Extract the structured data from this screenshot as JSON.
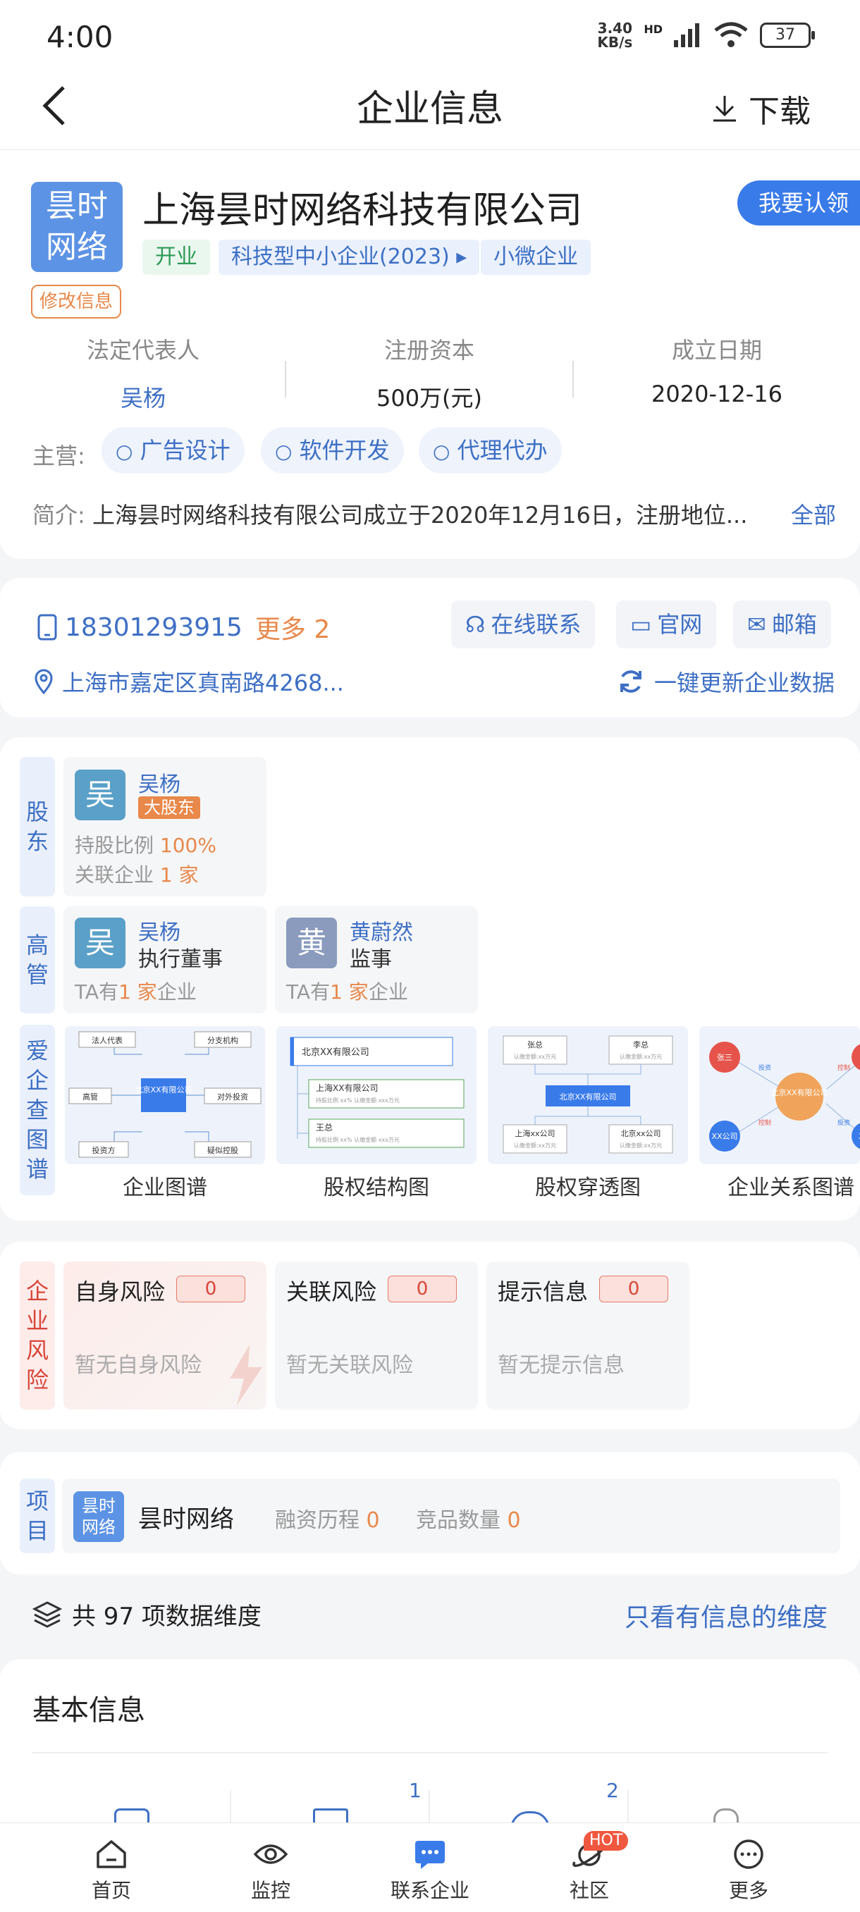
{
  "status_bar": {
    "time": "4:00",
    "net_speed_top": "3.40",
    "net_speed_bottom": "KB/s",
    "hd": "HD",
    "battery": "37"
  },
  "nav": {
    "title": "企业信息",
    "download": "下载"
  },
  "company": {
    "logo_line1": "昙时",
    "logo_line2": "网络",
    "name": "上海昙时网络科技有限公司",
    "claim": "我要认领",
    "tags": [
      "开业",
      "科技型中小企业(2023) ▸",
      "小微企业"
    ],
    "modify": "修改信息",
    "legal_rep_label": "法定代表人",
    "legal_rep": "吴杨",
    "capital_label": "注册资本",
    "capital": "500万(元)",
    "founded_label": "成立日期",
    "founded": "2020-12-16",
    "main_label": "主营:",
    "main_chips": [
      "广告设计",
      "软件开发",
      "代理代办"
    ],
    "intro_label": "简介:",
    "intro": "上海昙时网络科技有限公司成立于2020年12月16日，注册地位...",
    "intro_all": "全部"
  },
  "contact": {
    "phone": "18301293915",
    "more": "更多 2",
    "online": "在线联系",
    "website": "官网",
    "email": "邮箱",
    "address": "上海市嘉定区真南路4268...",
    "refresh": "一键更新企业数据"
  },
  "shareholders": {
    "label": [
      "股",
      "东"
    ],
    "name": "吴杨",
    "avatar": "吴",
    "badge": "大股东",
    "ratio_label": "持股比例",
    "ratio": "100%",
    "related_label": "关联企业",
    "related": "1 家"
  },
  "executives": {
    "label": [
      "高",
      "管"
    ],
    "items": [
      {
        "avatar": "吴",
        "name": "吴杨",
        "role": "执行董事",
        "pre": "TA有",
        "count": "1 家",
        "post": "企业"
      },
      {
        "avatar": "黄",
        "name": "黄蔚然",
        "role": "监事",
        "pre": "TA有",
        "count": "1 家",
        "post": "企业"
      }
    ]
  },
  "graphs": {
    "label": [
      "爱",
      "企",
      "查",
      "图",
      "谱"
    ],
    "items": [
      "企业图谱",
      "股权结构图",
      "股权穿透图",
      "企业关系图谱"
    ],
    "g1": {
      "center": "北京XX有限公司",
      "nodes": [
        "法人代表",
        "分支机构",
        "高管",
        "对外投资",
        "投资方",
        "疑似控股"
      ]
    },
    "g2": {
      "nodes": [
        "北京XX有限公司",
        "上海XX有限公司",
        "王总"
      ],
      "sub1": "持股比例 xx%  认缴金额 xxx万元",
      "sub2": "持股比例 xx%  认缴金额 xxx万元"
    },
    "g3": {
      "top": [
        "张总",
        "李总"
      ],
      "sub": "认缴金额:xx万元",
      "center": "北京XX有限公司",
      "bottom": [
        "上海xx公司",
        "北京xx公司"
      ]
    },
    "g4": {
      "center": "北京XX有限公司",
      "left": "张三",
      "bottom": "XX公司",
      "edge1": "投资",
      "edge2": "控制",
      "edge3": "控制",
      "edge4": "投资",
      "right_partial": "XX"
    }
  },
  "risk": {
    "label": [
      "企",
      "业",
      "风",
      "险"
    ],
    "items": [
      {
        "title": "自身风险",
        "count": "0",
        "none": "暂无自身风险"
      },
      {
        "title": "关联风险",
        "count": "0",
        "none": "暂无关联风险"
      },
      {
        "title": "提示信息",
        "count": "0",
        "none": "暂无提示信息"
      }
    ]
  },
  "project": {
    "label": [
      "项",
      "目"
    ],
    "logo_line1": "昙时",
    "logo_line2": "网络",
    "name": "昙时网络",
    "funding_label": "融资历程",
    "funding": "0",
    "competitor_label": "竞品数量",
    "competitor": "0"
  },
  "dimensions": {
    "text": "共 97 项数据维度",
    "only": "只看有信息的维度"
  },
  "basic": {
    "title": "基本信息",
    "counts": [
      "1",
      "2"
    ]
  },
  "tabs": [
    "首页",
    "监控",
    "联系企业",
    "社区",
    "更多"
  ],
  "hot": "HOT",
  "colors": {
    "accent": "#3e6fc4",
    "brand_blue": "#3a7bea",
    "orange": "#e8884a",
    "risk_red": "#d9453a"
  }
}
